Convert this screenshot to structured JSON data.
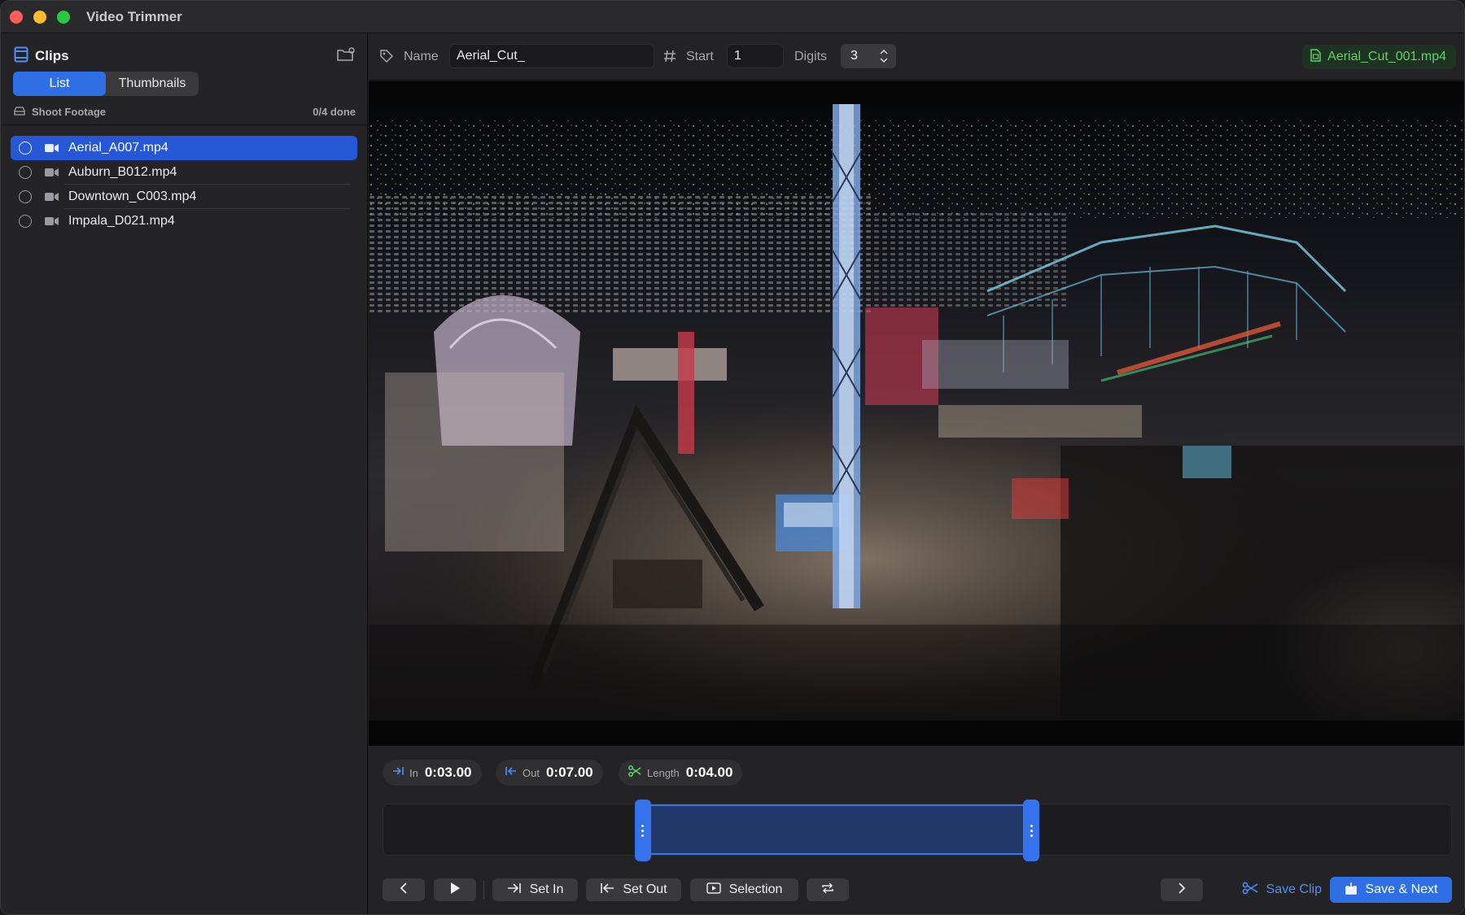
{
  "window": {
    "title": "Video Trimmer"
  },
  "sidebar": {
    "title": "Clips",
    "view_modes": [
      {
        "label": "List",
        "active": true
      },
      {
        "label": "Thumbnails",
        "active": false
      }
    ],
    "folder_label": "Shoot Footage",
    "progress": "0/4 done",
    "clips": [
      {
        "name": "Aerial_A007.mp4",
        "selected": true,
        "done": false
      },
      {
        "name": "Auburn_B012.mp4",
        "selected": false,
        "done": false
      },
      {
        "name": "Downtown_C003.mp4",
        "selected": false,
        "done": false
      },
      {
        "name": "Impala_D021.mp4",
        "selected": false,
        "done": false
      }
    ]
  },
  "toolbar": {
    "name_label": "Name",
    "name_value": "Aerial_Cut_",
    "start_label": "Start",
    "start_value": "1",
    "digits_label": "Digits",
    "digits_value": "3",
    "output_filename": "Aerial_Cut_001.mp4"
  },
  "trim": {
    "in_label": "In",
    "in_value": "0:03.00",
    "out_label": "Out",
    "out_value": "0:07.00",
    "length_label": "Length",
    "length_value": "0:04.00",
    "selection_start_fraction": 0.243,
    "selection_end_fraction": 0.607
  },
  "buttons": {
    "set_in": "Set In",
    "set_out": "Set Out",
    "selection": "Selection",
    "save_clip": "Save Clip",
    "save_next": "Save & Next"
  },
  "colors": {
    "accent": "#2f6fe6",
    "success": "#5ed26a",
    "selection_fill": "#23386a"
  }
}
